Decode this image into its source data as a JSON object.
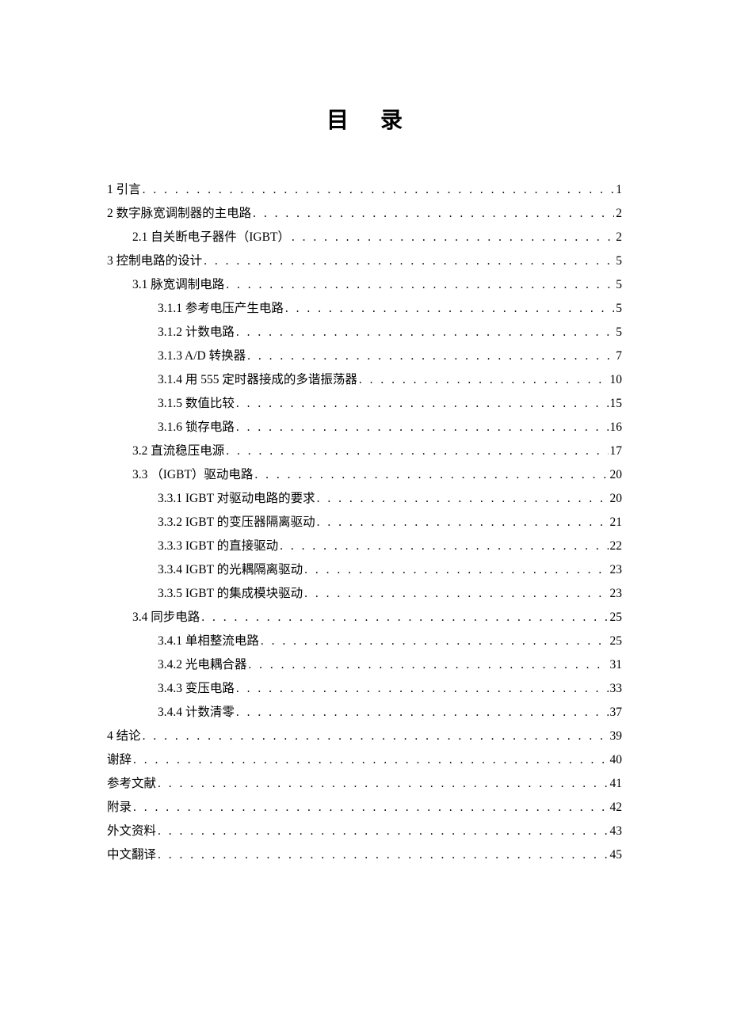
{
  "title": "目录",
  "toc": [
    {
      "level": 0,
      "label": "1  引言",
      "page": "1"
    },
    {
      "level": 0,
      "label": "2  数字脉宽调制器的主电路",
      "page": "2"
    },
    {
      "level": 1,
      "label": "2.1 自关断电子器件（IGBT）",
      "page": "2"
    },
    {
      "level": 0,
      "label": "3 控制电路的设计",
      "page": "5"
    },
    {
      "level": 1,
      "label": "3.1 脉宽调制电路",
      "page": "5"
    },
    {
      "level": 2,
      "label": "3.1.1 参考电压产生电路",
      "page": "5"
    },
    {
      "level": 2,
      "label": "3.1.2 计数电路",
      "page": "5"
    },
    {
      "level": 2,
      "label": "3.1.3 A/D 转换器",
      "page": "7"
    },
    {
      "level": 2,
      "label": "3.1.4 用 555 定时器接成的多谐振荡器",
      "page": "10"
    },
    {
      "level": 2,
      "label": "3.1.5 数值比较",
      "page": "15"
    },
    {
      "level": 2,
      "label": "3.1.6 锁存电路",
      "page": "16"
    },
    {
      "level": 1,
      "label": "3.2 直流稳压电源",
      "page": "17"
    },
    {
      "level": 1,
      "label": "3.3 （IGBT）驱动电路",
      "page": "20"
    },
    {
      "level": 2,
      "label": "3.3.1  IGBT 对驱动电路的要求",
      "page": "20"
    },
    {
      "level": 2,
      "label": "3.3.2  IGBT 的变压器隔离驱动",
      "page": "21"
    },
    {
      "level": 2,
      "label": "3.3.3 IGBT 的直接驱动",
      "page": "22"
    },
    {
      "level": 2,
      "label": "3.3.4  IGBT 的光耦隔离驱动",
      "page": "23"
    },
    {
      "level": 2,
      "label": "3.3.5  IGBT 的集成模块驱动",
      "page": "23"
    },
    {
      "level": 1,
      "label": "3.4 同步电路",
      "page": "25"
    },
    {
      "level": 2,
      "label": "3.4.1 单相整流电路",
      "page": "25"
    },
    {
      "level": 2,
      "label": "3.4.2 光电耦合器",
      "page": "31"
    },
    {
      "level": 2,
      "label": "3.4.3 变压电路",
      "page": "33"
    },
    {
      "level": 2,
      "label": "3.4.4 计数清零",
      "page": "37"
    },
    {
      "level": 0,
      "label": "4  结论",
      "page": "39"
    },
    {
      "level": 0,
      "label": "谢辞",
      "page": "40"
    },
    {
      "level": 0,
      "label": "参考文献",
      "page": "41"
    },
    {
      "level": 0,
      "label": "附录",
      "page": "42"
    },
    {
      "level": 0,
      "label": "外文资料",
      "page": "43"
    },
    {
      "level": 0,
      "label": "中文翻译",
      "page": "45"
    }
  ]
}
